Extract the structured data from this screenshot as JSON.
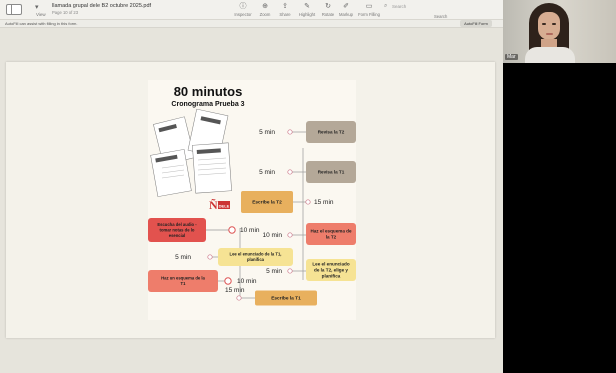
{
  "window": {
    "title": "llamada grupal dele B2 octubre 2025.pdf",
    "subtitle": "Page 10 of 23",
    "view_label": "View",
    "toolbar": [
      {
        "label": "Inspector",
        "icon": "info-icon",
        "glyph": "ⓘ"
      },
      {
        "label": "Zoom",
        "icon": "zoom-icon",
        "glyph": "⊕"
      },
      {
        "label": "Share",
        "icon": "share-icon",
        "glyph": "⇪"
      },
      {
        "label": "Highlight",
        "icon": "highlight-icon",
        "glyph": "✎"
      },
      {
        "label": "Rotate",
        "icon": "rotate-icon",
        "glyph": "↻"
      },
      {
        "label": "Markup",
        "icon": "markup-icon",
        "glyph": "✐"
      },
      {
        "label": "Form Filling",
        "icon": "form-icon",
        "glyph": "▭"
      }
    ],
    "search": {
      "placeholder": "Search",
      "label": "Search"
    },
    "notice": "AutoFill can assist with filling in this form.",
    "autofill_button": "AutoFill Form"
  },
  "infographic": {
    "title": "80 minutos",
    "subtitle": "Cronograma Prueba 3",
    "logo_text": "DELE",
    "colors": {
      "taupe": "#b4a898",
      "orange": "#e8b05e",
      "salmon": "#ee7d6b",
      "yellow": "#f6e394",
      "red": "#e2524e"
    },
    "right": [
      {
        "time": "5 min",
        "label": "Revisa la T2",
        "color": "taupe"
      },
      {
        "time": "5 min",
        "label": "Revisa la T1",
        "color": "taupe"
      },
      {
        "time": "10 min",
        "label": "Haz el esquema de la T2",
        "color": "salmon"
      },
      {
        "time": "5 min",
        "label": "Lee el enunciado de la T2, elige y planifica",
        "color": "yellow"
      }
    ],
    "center": [
      {
        "time": "15 min",
        "label": "Escribe la T2",
        "color": "orange"
      },
      {
        "time": "15 min",
        "label": "Escribe la T1",
        "color": "orange"
      }
    ],
    "left": [
      {
        "time": "10 min",
        "label": "Escucha del audio - tomar notas de lo esencial",
        "color": "red"
      },
      {
        "time": "5 min",
        "label": "Lee el enunciado de la T1, planifica",
        "color": "yellow"
      },
      {
        "time": "10 min",
        "label": "Haz un esquema de la T1",
        "color": "salmon"
      }
    ]
  },
  "participant": {
    "name": "Mar"
  }
}
